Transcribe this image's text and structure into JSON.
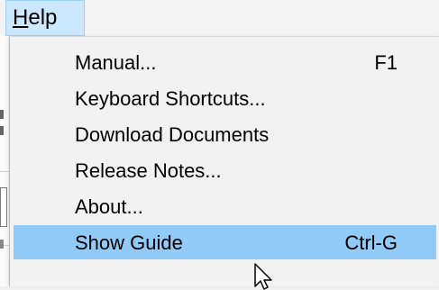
{
  "menubar": {
    "help": {
      "label": "Help"
    }
  },
  "menu": {
    "items": [
      {
        "label": "Manual...",
        "shortcut": "F1"
      },
      {
        "label": "Keyboard Shortcuts...",
        "shortcut": ""
      },
      {
        "label": "Download Documents",
        "shortcut": ""
      },
      {
        "label": "Release Notes...",
        "shortcut": ""
      },
      {
        "label": "About...",
        "shortcut": ""
      },
      {
        "label": "Show Guide",
        "shortcut": "Ctrl-G",
        "highlighted": true
      }
    ]
  },
  "colors": {
    "highlight": "#91c9f7",
    "menubar_active": "#cce8ff"
  },
  "cursor": {
    "icon": "arrow-cursor-icon"
  }
}
